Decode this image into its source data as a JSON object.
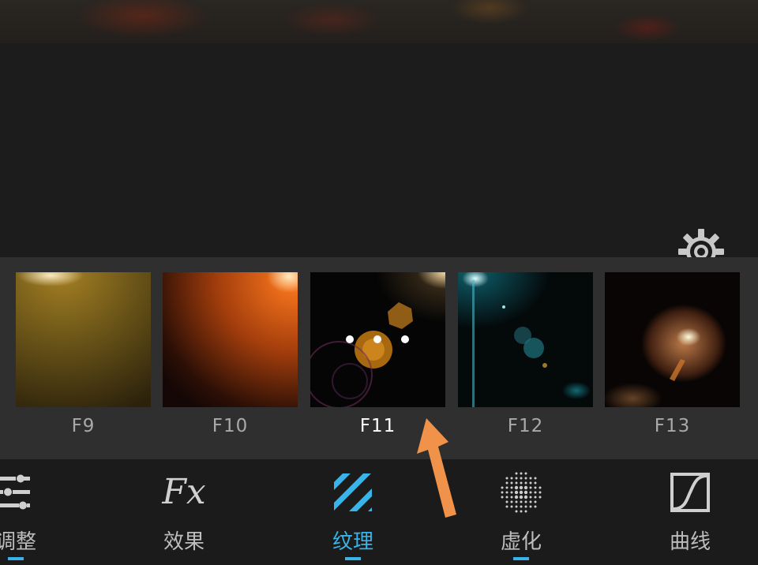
{
  "filters": [
    {
      "label": "F9",
      "selected": false
    },
    {
      "label": "F10",
      "selected": false
    },
    {
      "label": "F11",
      "selected": true
    },
    {
      "label": "F12",
      "selected": false
    },
    {
      "label": "F13",
      "selected": false
    }
  ],
  "tabs": [
    {
      "label": "调整",
      "icon": "sliders-icon",
      "active": false
    },
    {
      "label": "效果",
      "icon": "fx-icon",
      "active": false
    },
    {
      "label": "纹理",
      "icon": "texture-stripes-icon",
      "active": true
    },
    {
      "label": "虚化",
      "icon": "blur-dots-icon",
      "active": false
    },
    {
      "label": "曲线",
      "icon": "curve-icon",
      "active": false
    }
  ],
  "fx_glyph": "Fx",
  "colors": {
    "accent": "#3ab4e8",
    "arrow": "#f0924a",
    "background": "#1b1b1b",
    "strip": "#2f2f2f"
  }
}
